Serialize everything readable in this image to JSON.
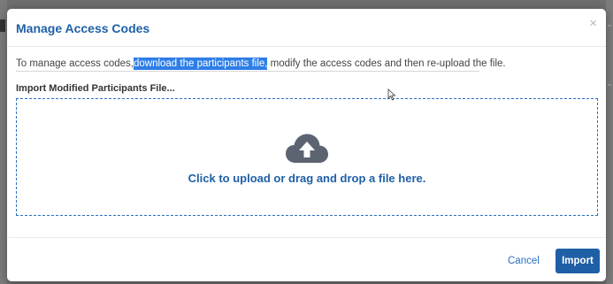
{
  "dialog": {
    "title": "Manage Access Codes",
    "close_symbol": "×"
  },
  "intro": {
    "before": "To manage access codes,",
    "link": "download the participants file,",
    "after": " modify the access codes and then re-upload the file."
  },
  "upload": {
    "label": "Import Modified Participants File...",
    "prompt": "Click to upload or drag and drop a file here.",
    "icon": "cloud-upload-icon"
  },
  "footer": {
    "cancel_label": "Cancel",
    "import_label": "Import"
  },
  "colors": {
    "accent": "#1f5fa6",
    "highlight": "#2e7ee8",
    "icon_gray": "#5b6470"
  }
}
